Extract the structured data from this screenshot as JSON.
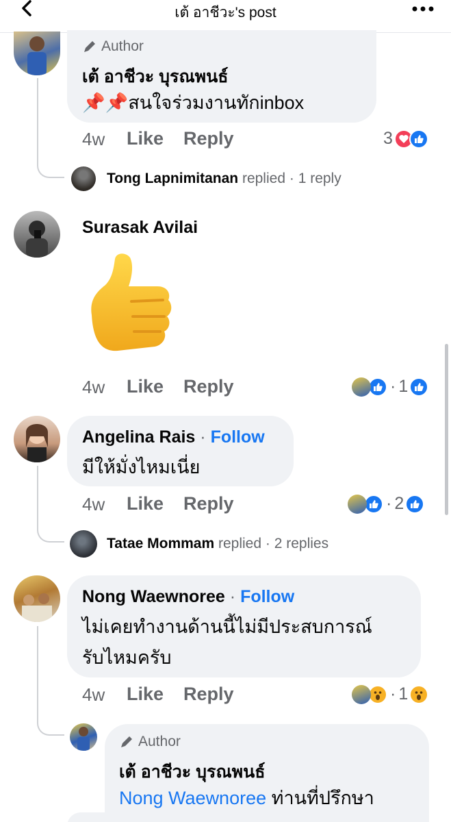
{
  "header": {
    "title": "เต้ อาชีวะ's post"
  },
  "comments": [
    {
      "author_tag": "Author",
      "name": "เต้ อาชีวะ บุรณพนธ์",
      "text": "สนใจร่วมงานทักinbox",
      "emoji": "📌📌",
      "time": "4w",
      "like": "Like",
      "reply": "Reply",
      "reactions_count": "3",
      "replied_by": "Tong Lapnimitanan",
      "replied_word": "replied",
      "replies_count": "1 reply"
    },
    {
      "name": "Surasak Avilai",
      "sticker": "thumbs-up",
      "time": "4w",
      "like": "Like",
      "reply": "Reply",
      "reactions_count": "1"
    },
    {
      "name": "Angelina Rais",
      "follow": "Follow",
      "text": "มีให้มั่งไหมเนี่ย",
      "time": "4w",
      "like": "Like",
      "reply": "Reply",
      "reactions_count": "2",
      "replied_by": "Tatae Mommam",
      "replied_word": "replied",
      "replies_count": "2 replies"
    },
    {
      "name": "Nong Waewnoree",
      "follow": "Follow",
      "text_line1": "ไม่เคยทำงานด้านนี้ไม่มีประสบการณ์",
      "text_line2": "รับไหมครับ",
      "time": "4w",
      "like": "Like",
      "reply": "Reply",
      "reactions_count": "1"
    },
    {
      "author_tag": "Author",
      "name": "เต้ อาชีวะ บุรณพนธ์",
      "mention": "Nong Waewnoree",
      "text": "ท่านที่ปรึกษา"
    }
  ],
  "separator": "·",
  "colors": {
    "accent": "#1877f2",
    "bubble": "#f0f2f5",
    "muted": "#65676b"
  }
}
